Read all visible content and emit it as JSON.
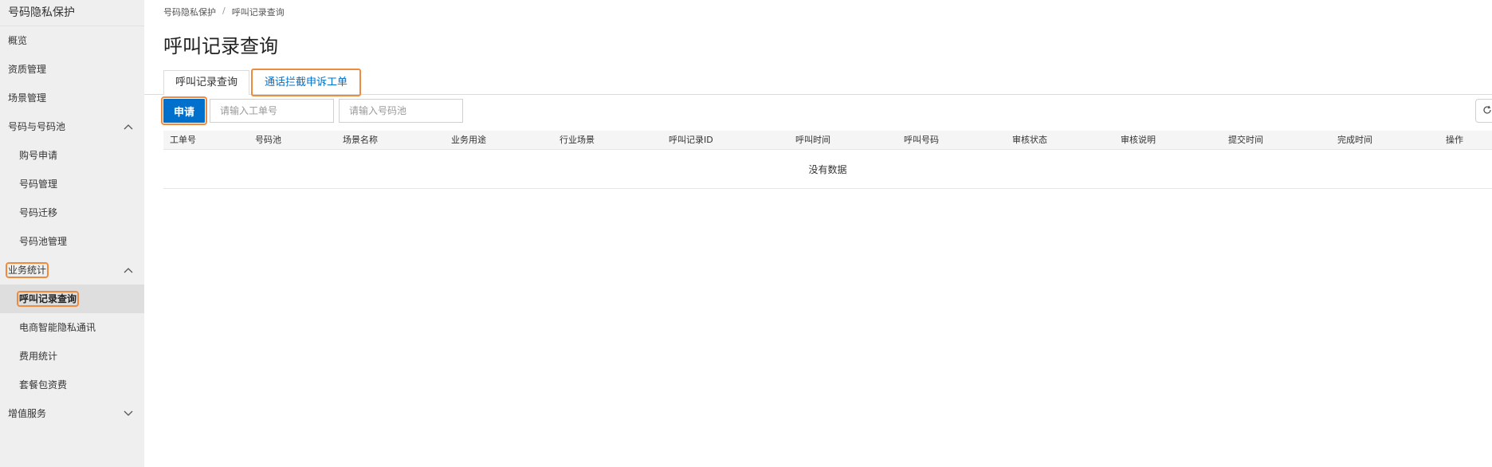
{
  "sidebar": {
    "title": "号码隐私保护",
    "items": [
      {
        "label": "概览"
      },
      {
        "label": "资质管理"
      },
      {
        "label": "场景管理"
      },
      {
        "label": "号码与号码池"
      },
      {
        "label": "购号申请"
      },
      {
        "label": "号码管理"
      },
      {
        "label": "号码迁移"
      },
      {
        "label": "号码池管理"
      },
      {
        "label": "业务统计"
      },
      {
        "label": "呼叫记录查询"
      },
      {
        "label": "电商智能隐私通讯"
      },
      {
        "label": "费用统计"
      },
      {
        "label": "套餐包资费"
      },
      {
        "label": "增值服务"
      }
    ]
  },
  "breadcrumb": {
    "root": "号码隐私保护",
    "separator": "/",
    "current": "呼叫记录查询"
  },
  "page": {
    "title": "呼叫记录查询"
  },
  "tabs": [
    {
      "label": "呼叫记录查询"
    },
    {
      "label": "通话拦截申诉工单"
    }
  ],
  "toolbar": {
    "apply_label": "申请",
    "ticket_placeholder": "请输入工单号",
    "pool_placeholder": "请输入号码池"
  },
  "table": {
    "columns": [
      "工单号",
      "号码池",
      "场景名称",
      "业务用途",
      "行业场景",
      "呼叫记录ID",
      "呼叫时间",
      "呼叫号码",
      "审核状态",
      "审核说明",
      "提交时间",
      "完成时间",
      "操作"
    ],
    "empty_text": "没有数据"
  },
  "colors": {
    "accent": "#0070cc",
    "highlight": "#f08a3e",
    "sidebar_bg": "#efefef"
  }
}
